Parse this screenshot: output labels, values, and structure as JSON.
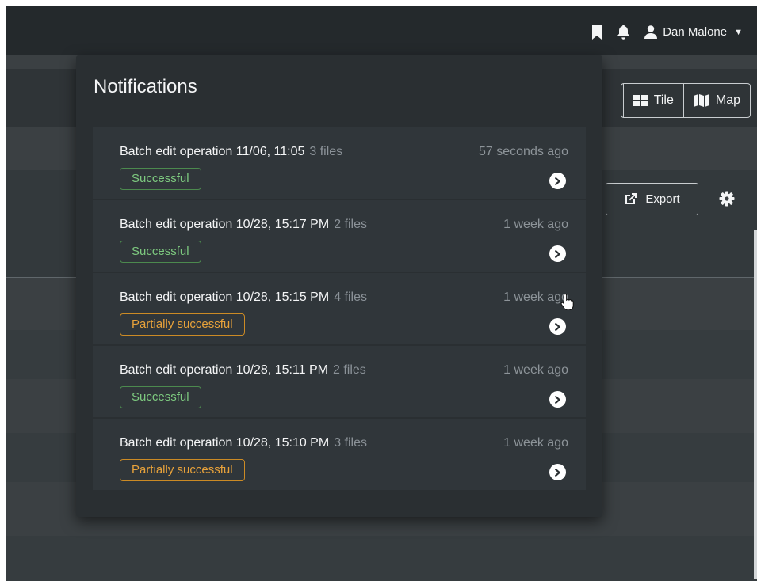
{
  "header": {
    "user_name": "Dan Malone",
    "icons": [
      "bookmark-icon",
      "bell-icon",
      "user-icon",
      "caret-down-icon"
    ]
  },
  "view_toggle": {
    "tile_label": "Tile",
    "map_label": "Map"
  },
  "toolbar": {
    "export_label": "Export"
  },
  "notifications": {
    "title": "Notifications",
    "items": [
      {
        "title": "Batch edit operation 11/06, 11:05",
        "files": "3 files",
        "time": "57 seconds ago",
        "status": "Successful",
        "status_type": "success"
      },
      {
        "title": "Batch edit operation 10/28, 15:17 PM",
        "files": "2 files",
        "time": "1 week ago",
        "status": "Successful",
        "status_type": "success"
      },
      {
        "title": "Batch edit operation 10/28, 15:15 PM",
        "files": "4 files",
        "time": "1 week ago",
        "status": "Partially successful",
        "status_type": "partial"
      },
      {
        "title": "Batch edit operation 10/28, 15:11 PM",
        "files": "2 files",
        "time": "1 week ago",
        "status": "Successful",
        "status_type": "success"
      },
      {
        "title": "Batch edit operation 10/28, 15:10 PM",
        "files": "3 files",
        "time": "1 week ago",
        "status": "Partially successful",
        "status_type": "partial"
      }
    ]
  },
  "colors": {
    "success": "#7dc97f",
    "partial": "#e8a23a",
    "panel_bg": "#2a2f32",
    "item_bg": "#30363a"
  }
}
